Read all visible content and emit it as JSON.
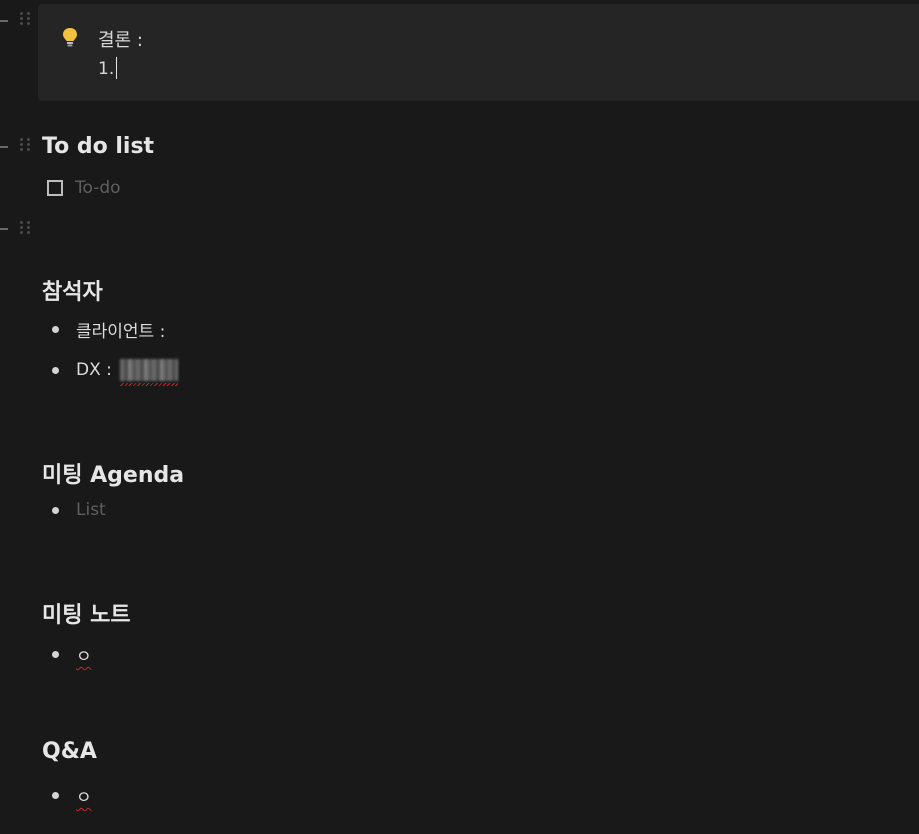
{
  "callout": {
    "icon": "lightbulb-icon",
    "title": "결론 :",
    "line1": "1."
  },
  "todo": {
    "heading": "To do list",
    "placeholder": "To-do"
  },
  "attendees": {
    "heading": "참석자",
    "items": [
      {
        "label": "클라이언트 :"
      },
      {
        "label": "DX :"
      }
    ]
  },
  "agenda": {
    "heading": "미팅 Agenda",
    "placeholder": "List"
  },
  "notes": {
    "heading": "미팅 노트",
    "item": "ㅇ"
  },
  "qa": {
    "heading": "Q&A",
    "item": "ㅇ"
  },
  "colors": {
    "background": "#191919",
    "callout_bg": "#252525",
    "spellcheck": "#c62828"
  }
}
